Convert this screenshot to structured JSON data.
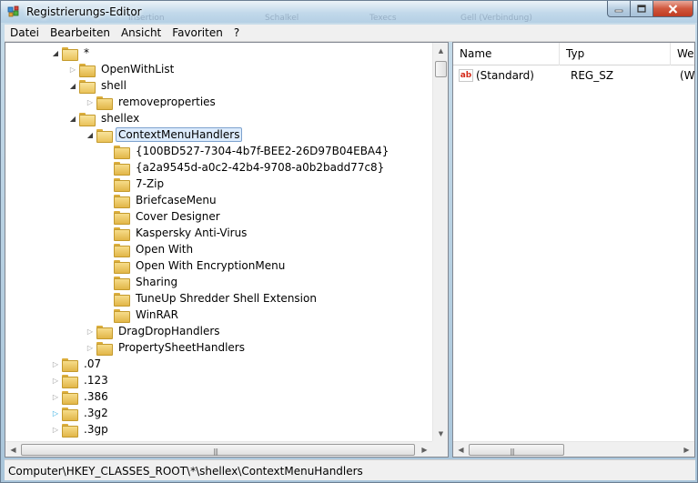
{
  "window": {
    "title": "Registrierungs-Editor",
    "ghost_taskbar_labels": [
      "Insertion",
      "Schalkel",
      "Texecs",
      "Gell (Verbindung)"
    ]
  },
  "menu": [
    "Datei",
    "Bearbeiten",
    "Ansicht",
    "Favoriten",
    "?"
  ],
  "tree": [
    {
      "label": "*",
      "expander": "open",
      "level": 0
    },
    {
      "label": "OpenWithList",
      "expander": "closed",
      "level": 1
    },
    {
      "label": "shell",
      "expander": "open",
      "level": 1
    },
    {
      "label": "removeproperties",
      "expander": "closed",
      "level": 2
    },
    {
      "label": "shellex",
      "expander": "open",
      "level": 1
    },
    {
      "label": "ContextMenuHandlers",
      "expander": "open",
      "level": 2,
      "selected": true
    },
    {
      "label": "{100BD527-7304-4b7f-BEE2-26D97B04EBA4}",
      "expander": "none",
      "level": 3
    },
    {
      "label": "{a2a9545d-a0c2-42b4-9708-a0b2badd77c8}",
      "expander": "none",
      "level": 3
    },
    {
      "label": "7-Zip",
      "expander": "none",
      "level": 3
    },
    {
      "label": "BriefcaseMenu",
      "expander": "none",
      "level": 3
    },
    {
      "label": "Cover Designer",
      "expander": "none",
      "level": 3
    },
    {
      "label": "Kaspersky Anti-Virus",
      "expander": "none",
      "level": 3
    },
    {
      "label": "Open With",
      "expander": "none",
      "level": 3
    },
    {
      "label": "Open With EncryptionMenu",
      "expander": "none",
      "level": 3
    },
    {
      "label": "Sharing",
      "expander": "none",
      "level": 3
    },
    {
      "label": "TuneUp Shredder Shell Extension",
      "expander": "none",
      "level": 3
    },
    {
      "label": "WinRAR",
      "expander": "none",
      "level": 3
    },
    {
      "label": "DragDropHandlers",
      "expander": "closed",
      "level": 2
    },
    {
      "label": "PropertySheetHandlers",
      "expander": "closed",
      "level": 2
    },
    {
      "label": ".07",
      "expander": "closed",
      "level": 0
    },
    {
      "label": ".123",
      "expander": "closed",
      "level": 0
    },
    {
      "label": ".386",
      "expander": "closed",
      "level": 0
    },
    {
      "label": ".3g2",
      "expander": "blue",
      "level": 0
    },
    {
      "label": ".3gp",
      "expander": "closed",
      "level": 0
    }
  ],
  "list": {
    "columns": [
      "Name",
      "Typ",
      "Wert"
    ],
    "rows": [
      {
        "name": "(Standard)",
        "type": "REG_SZ",
        "value": "(Wert nicht gesetzt)",
        "icon": "string-value-icon"
      }
    ]
  },
  "status": "Computer\\HKEY_CLASSES_ROOT\\*\\shellex\\ContextMenuHandlers"
}
